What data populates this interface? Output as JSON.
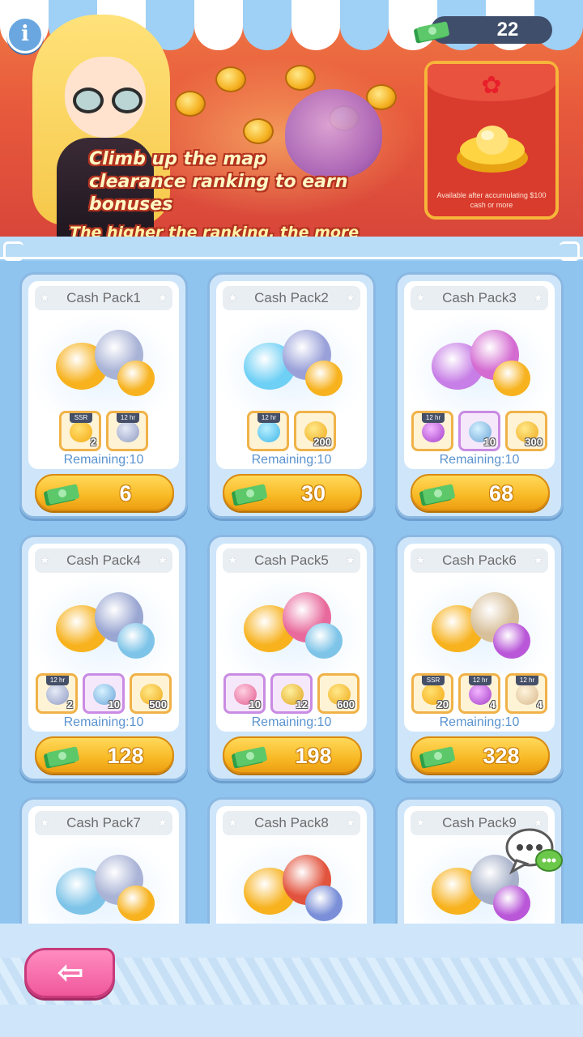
{
  "header": {
    "info_icon": "i",
    "currency_icon": "cash-icon",
    "currency_value": "22"
  },
  "banner": {
    "line1": "Climb up the map",
    "line2": "clearance ranking to earn bonuses",
    "line3": "The higher the ranking, the more bonuses!"
  },
  "envelope": {
    "icon": "red-envelope-gold-ingot",
    "note": "Available after accumulating $100 cash or more"
  },
  "packs": [
    {
      "title": "Cash Pack1",
      "remaining": "Remaining:10",
      "price": "6",
      "items": [
        {
          "icon": "ssr-puzzle-icon",
          "tag": "SSR",
          "qty": "2",
          "style": "gold"
        },
        {
          "icon": "silver-coins-icon",
          "tag": "12 hr",
          "qty": "",
          "style": "gold"
        }
      ]
    },
    {
      "title": "Cash Pack2",
      "remaining": "Remaining:10",
      "price": "30",
      "items": [
        {
          "icon": "blue-stars-icon",
          "tag": "12 hr",
          "qty": "",
          "style": "gold"
        },
        {
          "icon": "gold-coins-icon",
          "tag": "",
          "qty": "200",
          "style": "gold"
        }
      ]
    },
    {
      "title": "Cash Pack3",
      "remaining": "Remaining:10",
      "price": "68",
      "items": [
        {
          "icon": "purple-potion-icon",
          "tag": "12 hr",
          "qty": "",
          "style": "gold"
        },
        {
          "icon": "magic-wand-icon",
          "tag": "",
          "qty": "10",
          "style": "purple"
        },
        {
          "icon": "gold-coins-icon",
          "tag": "",
          "qty": "300",
          "style": "gold"
        }
      ]
    },
    {
      "title": "Cash Pack4",
      "remaining": "Remaining:10",
      "price": "128",
      "items": [
        {
          "icon": "silver-coins-icon",
          "tag": "12 hr",
          "qty": "2",
          "style": "gold"
        },
        {
          "icon": "magic-wand-icon",
          "tag": "",
          "qty": "10",
          "style": "purple"
        },
        {
          "icon": "gold-coins-icon",
          "tag": "",
          "qty": "500",
          "style": "gold"
        }
      ]
    },
    {
      "title": "Cash Pack5",
      "remaining": "Remaining:10",
      "price": "198",
      "items": [
        {
          "icon": "pink-wand-icon",
          "tag": "",
          "qty": "10",
          "style": "purple"
        },
        {
          "icon": "gold-key-icon",
          "tag": "",
          "qty": "12",
          "style": "purple"
        },
        {
          "icon": "gold-coins-icon",
          "tag": "",
          "qty": "600",
          "style": "gold"
        }
      ]
    },
    {
      "title": "Cash Pack6",
      "remaining": "Remaining:10",
      "price": "328",
      "items": [
        {
          "icon": "ssr-puzzle-icon",
          "tag": "SSR",
          "qty": "20",
          "style": "gold"
        },
        {
          "icon": "purple-potion-icon",
          "tag": "12 hr",
          "qty": "4",
          "style": "gold"
        },
        {
          "icon": "scroll-icon",
          "tag": "12 hr",
          "qty": "4",
          "style": "gold"
        }
      ]
    },
    {
      "title": "Cash Pack7",
      "remaining": "",
      "price": "",
      "items": []
    },
    {
      "title": "Cash Pack8",
      "remaining": "",
      "price": "",
      "items": []
    },
    {
      "title": "Cash Pack9",
      "remaining": "",
      "price": "",
      "items": []
    }
  ],
  "colors": {
    "banner": "#e85a3c",
    "grid_bg": "#8fc4ef",
    "button_gold": "#f8b925",
    "back_button": "#f0589c",
    "remaining_text": "#5b93cf"
  },
  "footer": {
    "back_icon": "back-arrow-icon",
    "back_glyph": "⇦",
    "chat_icon": "chat-bubbles-icon"
  }
}
